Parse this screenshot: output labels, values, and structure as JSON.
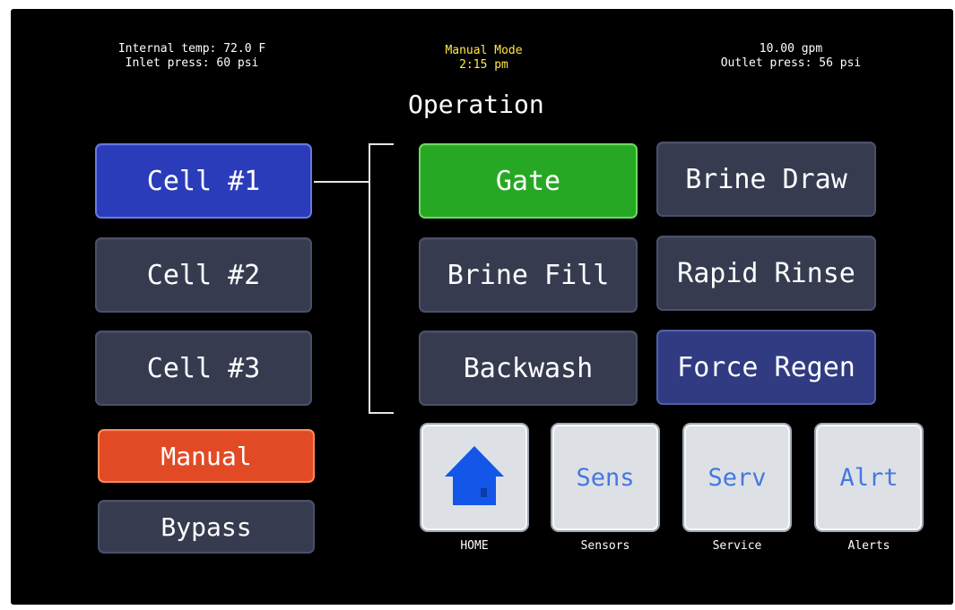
{
  "status": {
    "internal_temp": "Internal temp: 72.0 F",
    "inlet_press": "Inlet press: 60 psi",
    "mode": "Manual Mode",
    "time": "2:15 pm",
    "flow": "10.00 gpm",
    "outlet_press": "Outlet press: 56 psi"
  },
  "page_title": "Operation",
  "cells": [
    {
      "label": "Cell #1",
      "selected": true
    },
    {
      "label": "Cell #2",
      "selected": false
    },
    {
      "label": "Cell #3",
      "selected": false
    }
  ],
  "modes": {
    "manual": "Manual",
    "bypass": "Bypass"
  },
  "operations": {
    "gate": "Gate",
    "brine_draw": "Brine Draw",
    "brine_fill": "Brine Fill",
    "rapid_rinse": "Rapid Rinse",
    "backwash": "Backwash",
    "force_regen": "Force Regen"
  },
  "nav": [
    {
      "key": "home",
      "icon": "house-icon",
      "label": "",
      "caption": "HOME"
    },
    {
      "key": "sensors",
      "label": "Sens",
      "caption": "Sensors"
    },
    {
      "key": "service",
      "label": "Serv",
      "caption": "Service"
    },
    {
      "key": "alerts",
      "label": "Alrt",
      "caption": "Alerts"
    }
  ],
  "colors": {
    "selected_cell": "#2a3cba",
    "active_operation": "#27a824",
    "manual_mode": "#e24a26",
    "button_default": "#363b50",
    "force_regen": "#303b82",
    "status_mode_text": "#ffe94a",
    "nav_button": "#dde1e6",
    "nav_text": "#4477e0",
    "home_icon": "#1456e8"
  }
}
